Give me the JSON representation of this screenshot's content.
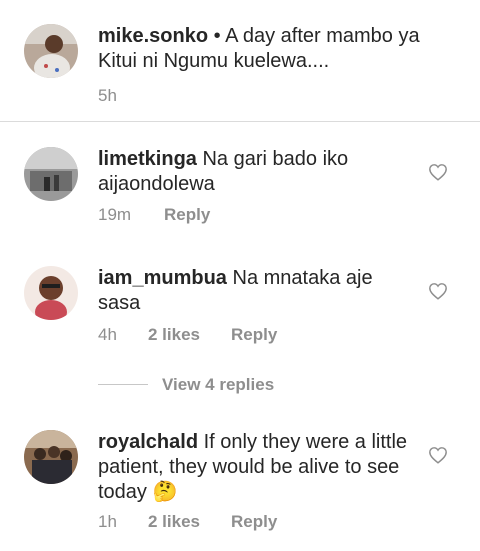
{
  "caption": {
    "username": "mike.sonko",
    "text": "• A day after mambo ya Kitui ni Ngumu kuelewa....",
    "time": "5h"
  },
  "comments": [
    {
      "username": "limetkinga",
      "text": "Na gari bado iko aijaondolewa",
      "time": "19m",
      "likes": "",
      "reply_label": "Reply",
      "icon": "heart-outline-icon"
    },
    {
      "username": "iam_mumbua",
      "text": "Na mnataka aje sasa",
      "time": "4h",
      "likes": "2 likes",
      "reply_label": "Reply",
      "icon": "heart-outline-icon"
    },
    {
      "username": "royalchald",
      "text": "If only they were a little patient, they would be alive to see today 🤔",
      "time": "1h",
      "likes": "2 likes",
      "reply_label": "Reply",
      "icon": "heart-outline-icon"
    }
  ],
  "view_replies": "View 4 replies",
  "colors": {
    "text": "#262626",
    "meta": "#8e8e8e",
    "divider": "#dbdbdb"
  }
}
